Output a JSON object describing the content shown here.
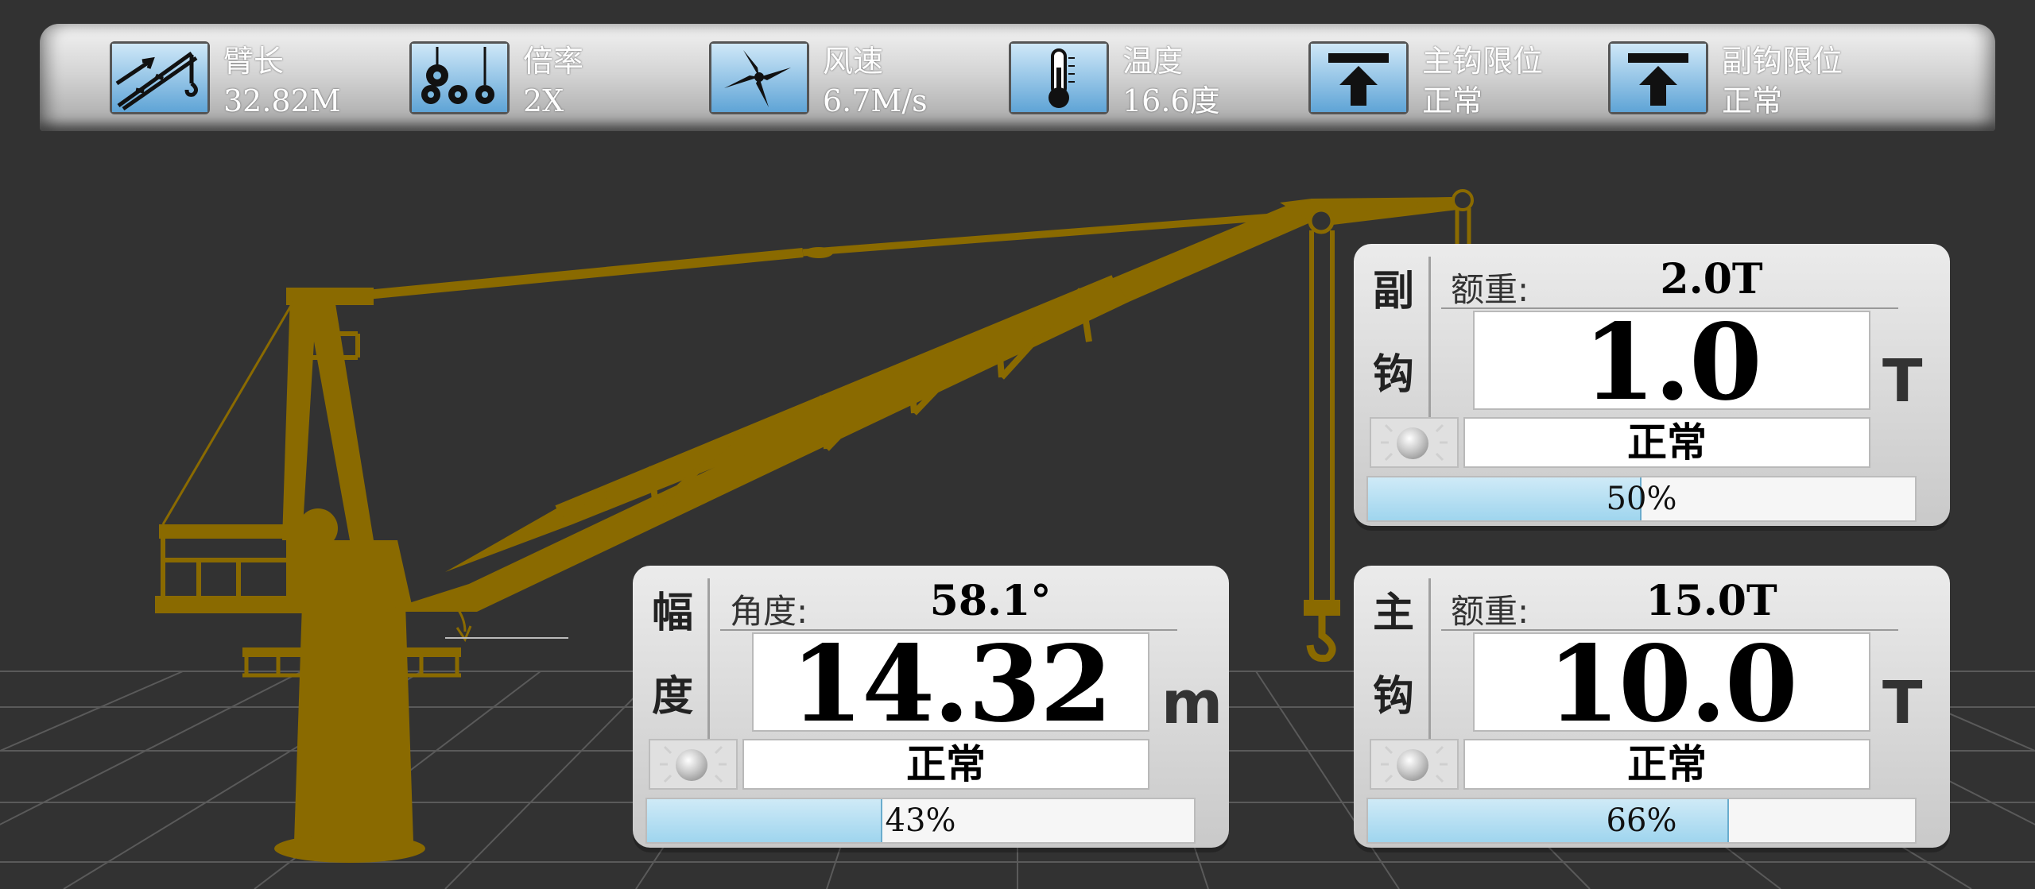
{
  "colors": {
    "background": "#323232",
    "crane": "#8a6a00",
    "progress_fill": "#a6d8ef",
    "topbar": "#c8c8c8"
  },
  "status_bar": [
    {
      "label": "臂长",
      "value": "32.82M",
      "icon": "boom-length-icon"
    },
    {
      "label": "倍率",
      "value": "2X",
      "icon": "pulley-ratio-icon"
    },
    {
      "label": "风速",
      "value": "6.7M/s",
      "icon": "windmill-icon"
    },
    {
      "label": "温度",
      "value": "16.6度",
      "icon": "thermometer-icon"
    },
    {
      "label": "主钩限位",
      "value": "正常",
      "icon": "limit-arrow-icon"
    },
    {
      "label": "副钩限位",
      "value": "正常",
      "icon": "limit-arrow-icon"
    }
  ],
  "panels": {
    "aux_hook": {
      "title_top": "副",
      "title_bottom": "钩",
      "rated_label": "额重:",
      "rated_value": "2.0T",
      "value": "1.0",
      "unit": "T",
      "state": "正常",
      "percent_text": "50%",
      "percent": 50
    },
    "amplitude": {
      "title_top": "幅",
      "title_bottom": "度",
      "rated_label": "角度:",
      "rated_value": "58.1°",
      "value": "14.32",
      "unit": "m",
      "state": "正常",
      "percent_text": "43%",
      "percent": 43
    },
    "main_hook": {
      "title_top": "主",
      "title_bottom": "钩",
      "rated_label": "额重:",
      "rated_value": "15.0T",
      "value": "10.0",
      "unit": "T",
      "state": "正常",
      "percent_text": "66%",
      "percent": 66
    }
  }
}
